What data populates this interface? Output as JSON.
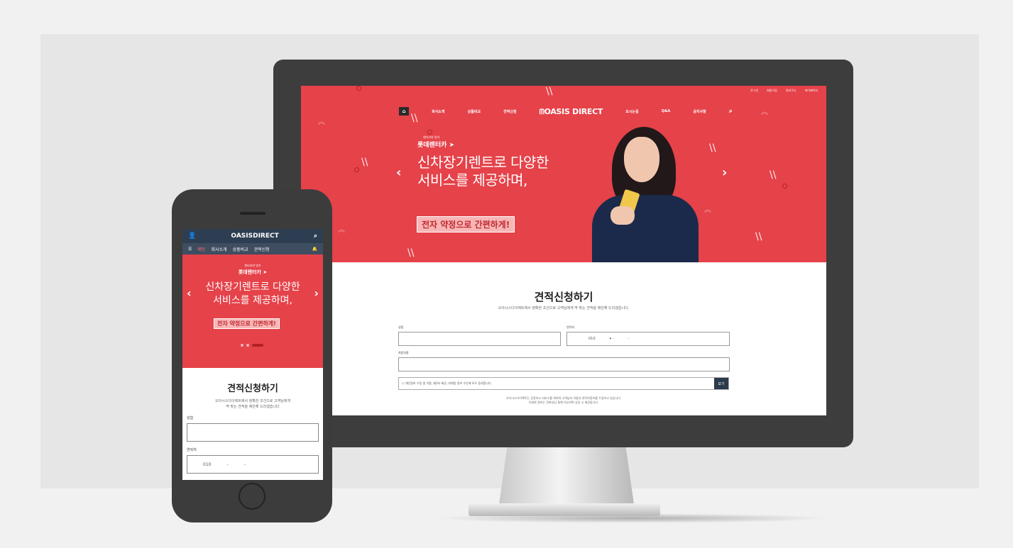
{
  "desktop": {
    "top_links": [
      "로그인",
      "회원가입",
      "장바구니",
      "마이페이지"
    ],
    "nav_left": [
      "회사소개",
      "상품비교",
      "견적신청"
    ],
    "logo": "OASIS DIRECT",
    "nav_right": [
      "오시는길",
      "Q&A",
      "공지사항"
    ],
    "brand_sub": "렌터카의 명가",
    "brand": "롯데렌터카",
    "headline_line1": "신차장기렌트로 다양한",
    "headline_line2": "서비스를 제공하며,",
    "cta": "전자 약정으로 간편하게!",
    "form_title": "견적신청하기",
    "form_subtitle": "오아시스다이렉트에서 정확한 조건으로 고객님에게 딱 맞는 견적을 제안해 드리겠습니다.",
    "label_name": "성함",
    "label_phone": "연락처",
    "label_car": "희망차종",
    "phone_prefix": "010",
    "agree_text": "개인정보 수집 및 이용, 제3자 제공, 마케팅 정보 수신에 모두 동의합니다.",
    "agree_button": "보기",
    "footnote_line1": "오아시스다이렉트는 공정하고 서비스를 위하여 고객님의 이름과 연락처정보를 수집하고 있습니다.",
    "footnote_line2": "자세한 정보는 전화상담 통해 가능하며 상담 시 제공됩니다."
  },
  "mobile": {
    "title": "OASISDIRECT",
    "menu": [
      "메인",
      "회사소개",
      "상품비교",
      "견적신청"
    ],
    "brand_sub": "렌터카의 명가",
    "brand": "롯데렌터카",
    "headline_line1": "신차장기렌트로 다양한",
    "headline_line2": "서비스를 제공하며,",
    "cta": "전자 약정으로 간편하게!",
    "form_title": "견적신청하기",
    "form_sub_line1": "오아시스다이렉트에서 정확한 조건으로 고객님에게",
    "form_sub_line2": "딱 맞는 견적을 제안해 드리겠습니다",
    "label_name": "성함",
    "label_phone": "연락처",
    "phone_prefix": "010"
  },
  "colors": {
    "accent": "#e5424a",
    "navy": "#2e3e52",
    "device": "#3d3d3d"
  }
}
